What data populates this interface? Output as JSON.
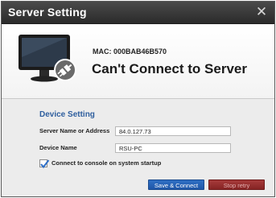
{
  "window": {
    "title": "Server Setting",
    "close_icon": "close-icon"
  },
  "status": {
    "mac": "MAC: 000BAB46B570",
    "message": "Can't Connect to Server"
  },
  "device_setting": {
    "heading": "Device Setting",
    "server_label": "Server Name or Address",
    "server_value": "84.0.127.73",
    "device_label": "Device Name",
    "device_value": "RSU-PC",
    "startup_label": "Connect to console on system startup",
    "startup_checked": true
  },
  "buttons": {
    "save_connect": "Save & Connect",
    "stop_retry": "Stop retry"
  },
  "colors": {
    "accent": "#2e5e9e",
    "primary_button": "#2463b6",
    "stop_button": "#962f2f",
    "titlebar": "#3a3a3a"
  }
}
